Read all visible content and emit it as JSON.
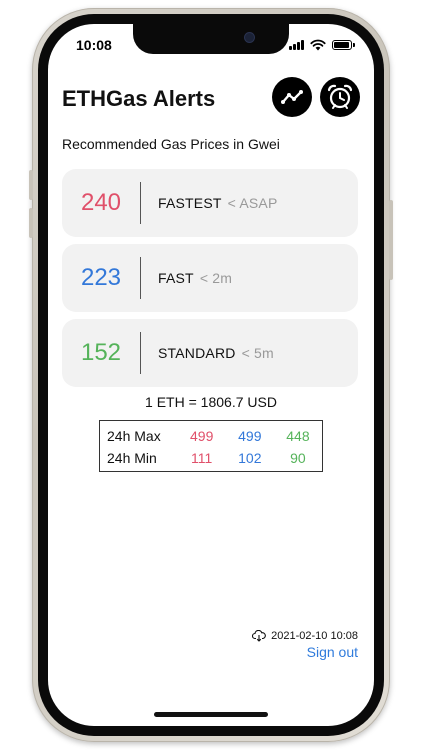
{
  "status": {
    "time": "10:08"
  },
  "header": {
    "title": "ETHGas Alerts"
  },
  "subtitle": "Recommended Gas Prices in Gwei",
  "colors": {
    "fastest": "#e0506a",
    "fast": "#3378d9",
    "standard": "#55b35a",
    "link": "#2f7bdc"
  },
  "gas": [
    {
      "price": "240",
      "speed": "FASTEST",
      "eta": "< ASAP"
    },
    {
      "price": "223",
      "speed": "FAST",
      "eta": "< 2m"
    },
    {
      "price": "152",
      "speed": "STANDARD",
      "eta": "< 5m"
    }
  ],
  "rate": "1 ETH = 1806.7 USD",
  "stats": {
    "max_label": "24h Max",
    "max": [
      "499",
      "499",
      "448"
    ],
    "min_label": "24h Min",
    "min": [
      "111",
      "102",
      "90"
    ]
  },
  "footer": {
    "updated": "2021-02-10 10:08",
    "signout": "Sign out"
  },
  "icons": {
    "chart": "trend-chart-icon",
    "alarm": "alarm-clock-icon",
    "cloud": "cloud-download-icon"
  }
}
